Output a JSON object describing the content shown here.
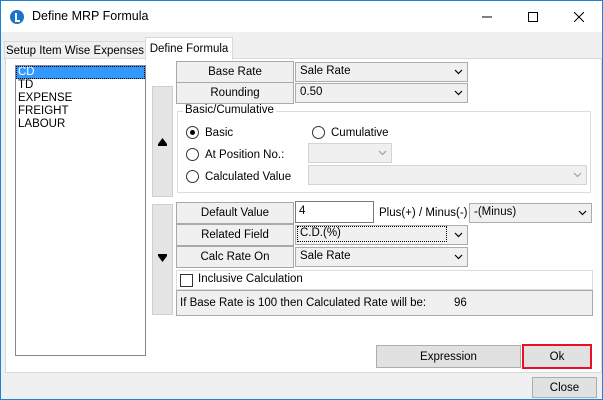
{
  "window": {
    "title": "Define MRP Formula"
  },
  "tabs": [
    {
      "label": "Setup Item Wise Expenses"
    },
    {
      "label": "Define Formula"
    }
  ],
  "expense_list": [
    "CD",
    "TD",
    "EXPENSE",
    "FREIGHT",
    "LABOUR"
  ],
  "base_rate": {
    "label": "Base Rate",
    "value": "Sale Rate"
  },
  "rounding": {
    "label": "Rounding",
    "value": "0.50"
  },
  "basic_cumulative": {
    "title": "Basic/Cumulative",
    "basic": "Basic",
    "cumulative": "Cumulative",
    "at_position": "At Position No.:",
    "calculated_value": "Calculated Value",
    "selected": "basic"
  },
  "default_value": {
    "label": "Default Value",
    "value": "4"
  },
  "plus_minus": {
    "label": "Plus(+) / Minus(-)",
    "value": "-(Minus)"
  },
  "related_field": {
    "label": "Related Field",
    "value": "C.D.(%)"
  },
  "calc_rate_on": {
    "label": "Calc Rate On",
    "value": "Sale Rate"
  },
  "inclusive": {
    "label": "Inclusive Calculation",
    "checked": false
  },
  "info": {
    "text": "If Base Rate is 100 then Calculated Rate will be:",
    "value": "96"
  },
  "buttons": {
    "expression": "Expression",
    "ok": "Ok",
    "close": "Close"
  },
  "colors": {
    "accent": "#1883d7",
    "ok_border": "#e81123",
    "selection": "#3399ff"
  }
}
